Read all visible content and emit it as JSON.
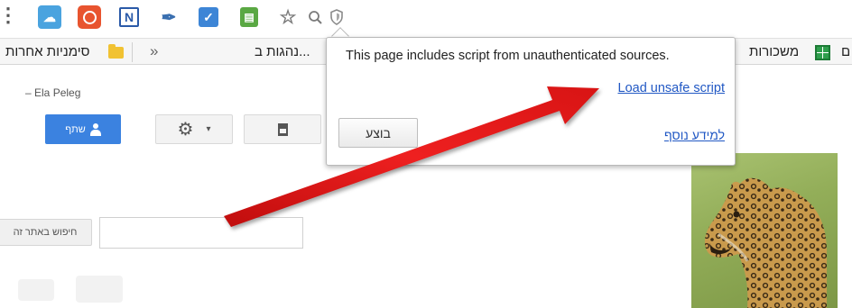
{
  "extensions": {
    "menu_icon": "menu-icon",
    "items": [
      "cloud-icon",
      "timer-icon",
      "onenote-icon",
      "tool-icon",
      "checkmark-icon",
      "green-app-icon",
      "star-icon",
      "zoom-icon",
      "shield-icon"
    ]
  },
  "bookmarks": {
    "left_folder_label": "סימניות אחרות",
    "more_glyph": "»",
    "partial_label": "נהגות ב...",
    "right_label": "משכורות",
    "edge_label": "ם"
  },
  "page": {
    "user_name": "Ela Peleg",
    "share_label": "שתף",
    "search_button_label": "חיפוש באתר זה"
  },
  "popup": {
    "message": "This page includes script from unauthenticated sources.",
    "load_link": "Load unsafe script",
    "done_button": "בוצע",
    "learn_more": "למידע נוסף"
  },
  "colors": {
    "accent_blue": "#3b82e0",
    "link_blue": "#2158c4",
    "arrow_red": "#e01818",
    "folder_yellow": "#f1c232",
    "sheet_green": "#2e9e4c"
  }
}
